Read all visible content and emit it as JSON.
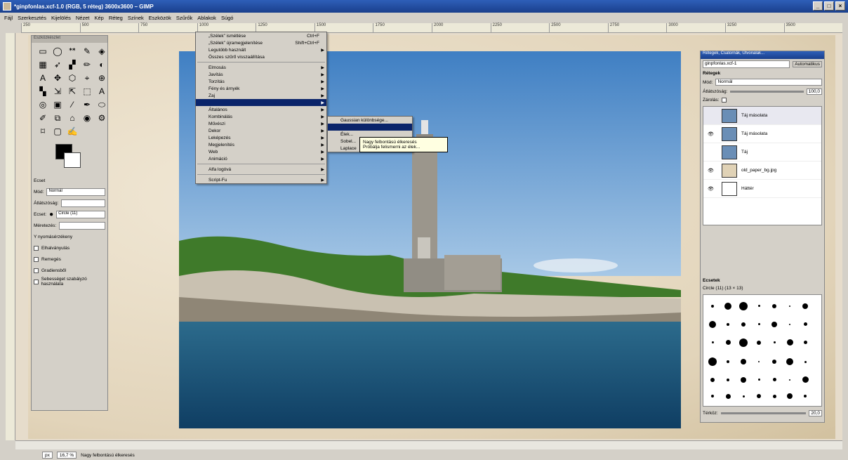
{
  "window": {
    "title": "*ginpfonlas.xcf-1.0 (RGB, 5 réteg) 3600x3600 – GIMP",
    "minimize": "_",
    "maximize": "□",
    "close": "×"
  },
  "menubar": [
    "Fájl",
    "Szerkesztés",
    "Kijelölés",
    "Nézet",
    "Kép",
    "Réteg",
    "Színek",
    "Eszközök",
    "Szűrők",
    "Ablakok",
    "Súgó"
  ],
  "ruler_marks": [
    "250",
    "500",
    "750",
    "1000",
    "1250",
    "1500",
    "1750",
    "2000",
    "2250",
    "2500",
    "2750",
    "3000",
    "3250",
    "3500"
  ],
  "toolbox": {
    "title": "Eszközkészlet",
    "tools": [
      "▭",
      "◯",
      "ᕯ",
      "✎",
      "◈",
      "▦",
      "➶",
      "▞",
      "✏",
      "◐",
      "A",
      "✥",
      "⬡",
      "⌖",
      "⊕",
      "▚",
      "⇲",
      "⇱",
      "⬚",
      "A",
      "◎",
      "▣",
      "⁄",
      "✒",
      "⬭",
      "✐",
      "⧉",
      "⌂",
      "◉",
      "⚙",
      "⌑",
      "▢",
      "✍"
    ],
    "options": {
      "title": "Ecset",
      "mode_label": "Mód:",
      "mode_value": "Normál",
      "opacity_label": "Átlátszóság:",
      "brush_label": "Ecset:",
      "brush_value": "Circle (11)",
      "scale_label": "Méretezés:",
      "pressure_label": "Y nyomásérzékeny",
      "checks": [
        "Elhalványulás",
        "Remegés",
        "Gradiensből",
        "Sebességet szabályzó használata"
      ]
    }
  },
  "filters_menu": {
    "items": [
      {
        "label": "„Szélek” ismétlése",
        "shortcut": "Ctrl+F"
      },
      {
        "label": "„Szélek” újramegjelenítése",
        "shortcut": "Shift+Ctrl+F"
      },
      {
        "label": "Legutóbb használt",
        "arrow": true
      },
      {
        "label": "Összes szűrő visszaállítása"
      },
      {
        "sep": true
      },
      {
        "label": "Elmosás",
        "arrow": true
      },
      {
        "label": "Javítás",
        "arrow": true
      },
      {
        "label": "Torzítás",
        "arrow": true
      },
      {
        "label": "Fény és árnyék",
        "arrow": true
      },
      {
        "label": "Zaj",
        "arrow": true
      },
      {
        "label": "",
        "arrow": true,
        "highlight": true
      },
      {
        "label": "Általános",
        "arrow": true
      },
      {
        "label": "Kombinálás",
        "arrow": true
      },
      {
        "label": "Művészi",
        "arrow": true
      },
      {
        "label": "Dekor",
        "arrow": true
      },
      {
        "label": "Leképezés",
        "arrow": true
      },
      {
        "label": "Megjelenítés",
        "arrow": true
      },
      {
        "label": "Web",
        "arrow": true
      },
      {
        "label": "Animáció",
        "arrow": true
      },
      {
        "sep": true
      },
      {
        "label": "Alfa logóvá",
        "arrow": true
      },
      {
        "sep": true
      },
      {
        "label": "Script-Fu",
        "arrow": true
      }
    ],
    "submenu": [
      {
        "label": "Gaussian különbsége..."
      },
      {
        "label": "",
        "highlight": true
      },
      {
        "label": "Élek..."
      },
      {
        "label": "Sobel..."
      },
      {
        "label": "Laplace"
      }
    ],
    "tooltip_line1": "Nagy felbontású élkeresés",
    "tooltip_line2": "Próbálja felismerni az élek..."
  },
  "dock": {
    "title": "Rétegek, Csatornák, Útvonalak...",
    "image_selector": "ginpfonlas.xcf-1",
    "auto_button": "Automatikus",
    "layers_label": "Rétegek",
    "mode_label": "Mód:",
    "mode_value": "Normál",
    "opacity_label": "Átlátszóság:",
    "opacity_value": "100,0",
    "lock_label": "Zárolás:",
    "layers": [
      {
        "name": "Táj másolata",
        "visible": false,
        "thumb": "#6a8eb6",
        "selected": true
      },
      {
        "name": "Táj másolata",
        "visible": true,
        "thumb": "#6a8eb6"
      },
      {
        "name": "Táj",
        "visible": false,
        "thumb": "#6a8eb6"
      },
      {
        "name": "old_paper_bg.jpg",
        "visible": true,
        "thumb": "#e0d2b6"
      },
      {
        "name": "Háttér",
        "visible": true,
        "thumb": "#ffffff"
      }
    ],
    "brushes_label": "Ecsetek",
    "brush_name": "Circle (11) (13 × 13)",
    "spacing_label": "Térköz:",
    "spacing_value": "20,0"
  },
  "statusbar": {
    "unit": "px",
    "zoom": "16,7 %",
    "message": "Nagy felbontású élkeresés"
  }
}
